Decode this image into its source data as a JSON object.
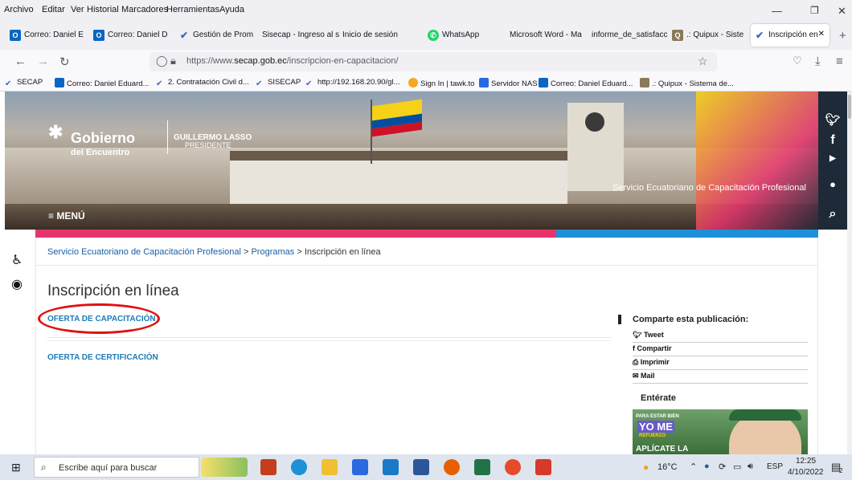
{
  "menubar": {
    "items": [
      "Archivo",
      "Editar",
      "Ver",
      "Historial",
      "Marcadores",
      "Herramientas",
      "Ayuda"
    ]
  },
  "tabs": [
    {
      "label": "Correo: Daniel E",
      "icon": "outlook-icon",
      "color": "#0a66c2"
    },
    {
      "label": "Correo: Daniel D",
      "icon": "outlook-icon",
      "color": "#0a66c2"
    },
    {
      "label": "Gestión de Prom",
      "icon": "secap-icon",
      "color": "#3a6ac0"
    },
    {
      "label": "Sisecap - Ingreso al s",
      "icon": "",
      "color": ""
    },
    {
      "label": "Inicio de sesión",
      "icon": "",
      "color": ""
    },
    {
      "label": "WhatsApp",
      "icon": "whatsapp-icon",
      "color": "#25d366"
    },
    {
      "label": "Microsoft Word - Ma",
      "icon": "",
      "color": ""
    },
    {
      "label": "informe_de_satisfacc",
      "icon": "",
      "color": ""
    },
    {
      "label": ".: Quipux - Siste",
      "icon": "quipux-icon",
      "color": "#8a7a5a"
    },
    {
      "label": "Inscripción en",
      "icon": "secap-icon",
      "color": "#3a6ac0",
      "active": true
    }
  ],
  "nav": {
    "url_prefix": "https://www.",
    "url_domain": "secap.gob.ec",
    "url_path": "/inscripcion-en-capacitacion/"
  },
  "bookmarks": [
    {
      "label": "SECAP",
      "color": "#3a6ac0"
    },
    {
      "label": "Correo: Daniel Eduard...",
      "color": "#0a66c2"
    },
    {
      "label": "2. Contratación Civil d...",
      "color": "#3a6ac0"
    },
    {
      "label": "SISECAP",
      "color": "#3a6ac0"
    },
    {
      "label": "http://192.168.20.90/gl...",
      "color": "#3a6ac0"
    },
    {
      "label": "Sign In | tawk.to",
      "color": "#f5a623"
    },
    {
      "label": "Servidor NAS",
      "color": "#2a6ae0"
    },
    {
      "label": "Correo: Daniel Eduard...",
      "color": "#0a66c2"
    },
    {
      "label": ".: Quipux - Sistema de...",
      "color": "#8a7a5a"
    }
  ],
  "header": {
    "gov_top": "Gobierno",
    "gov_bottom": "del Encuentro",
    "president_name": "GUILLERMO LASSO",
    "president_title": "PRESIDENTE",
    "menu_label": "≡ MENÚ",
    "site_name": "Servicio Ecuatoriano de Capacitación Profesional"
  },
  "breadcrumb": {
    "home": "Servicio Ecuatoriano de Capacitación Profesional",
    "sep": " > ",
    "section": "Programas",
    "current": "Inscripción en línea"
  },
  "main": {
    "title": "Inscripción en línea",
    "link1": "OFERTA DE CAPACITACIÓN",
    "link2": "OFERTA DE CERTIFICACIÓN"
  },
  "share": {
    "title": "Comparte esta publicación:",
    "tweet": "Tweet",
    "compartir": "Compartir",
    "imprimir": "Imprimir",
    "mail": "Mail",
    "enterate": "Entérate",
    "promo_top": "PARA ESTAR BIEN",
    "promo_big": "YO ME",
    "promo_sub": "REFUERZO",
    "promo_bottom": "APLÍCATE LA"
  },
  "taskbar": {
    "search_placeholder": "Escribe aquí para buscar",
    "temp": "16°C",
    "lang": "ESP",
    "time": "12:25",
    "date": "4/10/2022",
    "notif_count": "2"
  }
}
